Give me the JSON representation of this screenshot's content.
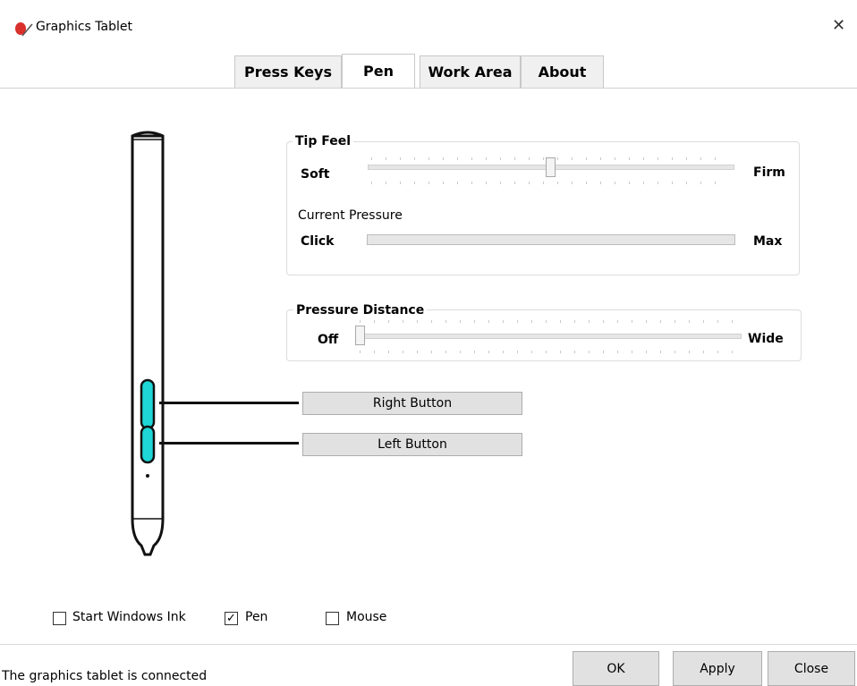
{
  "window": {
    "title": "Graphics Tablet",
    "close_glyph": "✕"
  },
  "tabs": [
    {
      "label": "Press Keys",
      "active": false
    },
    {
      "label": "Pen",
      "active": true
    },
    {
      "label": "Work Area",
      "active": false
    },
    {
      "label": "About",
      "active": false
    }
  ],
  "tip_feel": {
    "title": "Tip Feel",
    "left": "Soft",
    "right": "Firm",
    "level": 0.5,
    "pressure_title": "Current Pressure",
    "pressure_left": "Click",
    "pressure_right": "Max",
    "pressure_level": 0
  },
  "pressure_distance": {
    "title": "Pressure Distance",
    "left": "Off",
    "right": "Wide",
    "level": 0
  },
  "pen_buttons": {
    "right": "Right Button",
    "left": "Left Button",
    "accent": "#1ed6d6"
  },
  "checkboxes": [
    {
      "label": "Start Windows Ink",
      "checked": false
    },
    {
      "label": "Pen",
      "checked": true,
      "mark": "✓"
    },
    {
      "label": "Mouse",
      "checked": false
    }
  ],
  "status": "The graphics tablet is connected",
  "buttons": {
    "ok": "OK",
    "apply": "Apply",
    "close": "Close"
  }
}
